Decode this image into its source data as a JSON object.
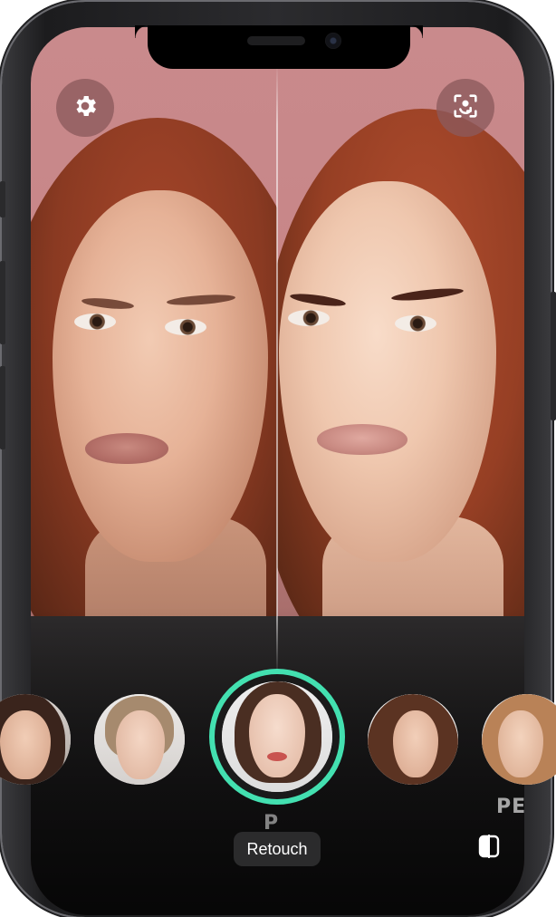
{
  "top_controls": {
    "settings_icon": "gear-icon",
    "camera_flip_icon": "camera-flip-icon"
  },
  "filter_carousel": {
    "items": [
      {
        "name": "filter-1",
        "selected": false
      },
      {
        "name": "filter-2",
        "selected": false
      },
      {
        "name": "filter-3",
        "selected": true
      },
      {
        "name": "filter-4",
        "selected": false
      },
      {
        "name": "filter-5",
        "selected": false
      }
    ],
    "selected_accent": "#43e0b0",
    "selected_caption": "P",
    "edge_caption": "PE"
  },
  "bottom_bar": {
    "mode_label": "Retouch",
    "compare_icon": "compare-icon"
  }
}
